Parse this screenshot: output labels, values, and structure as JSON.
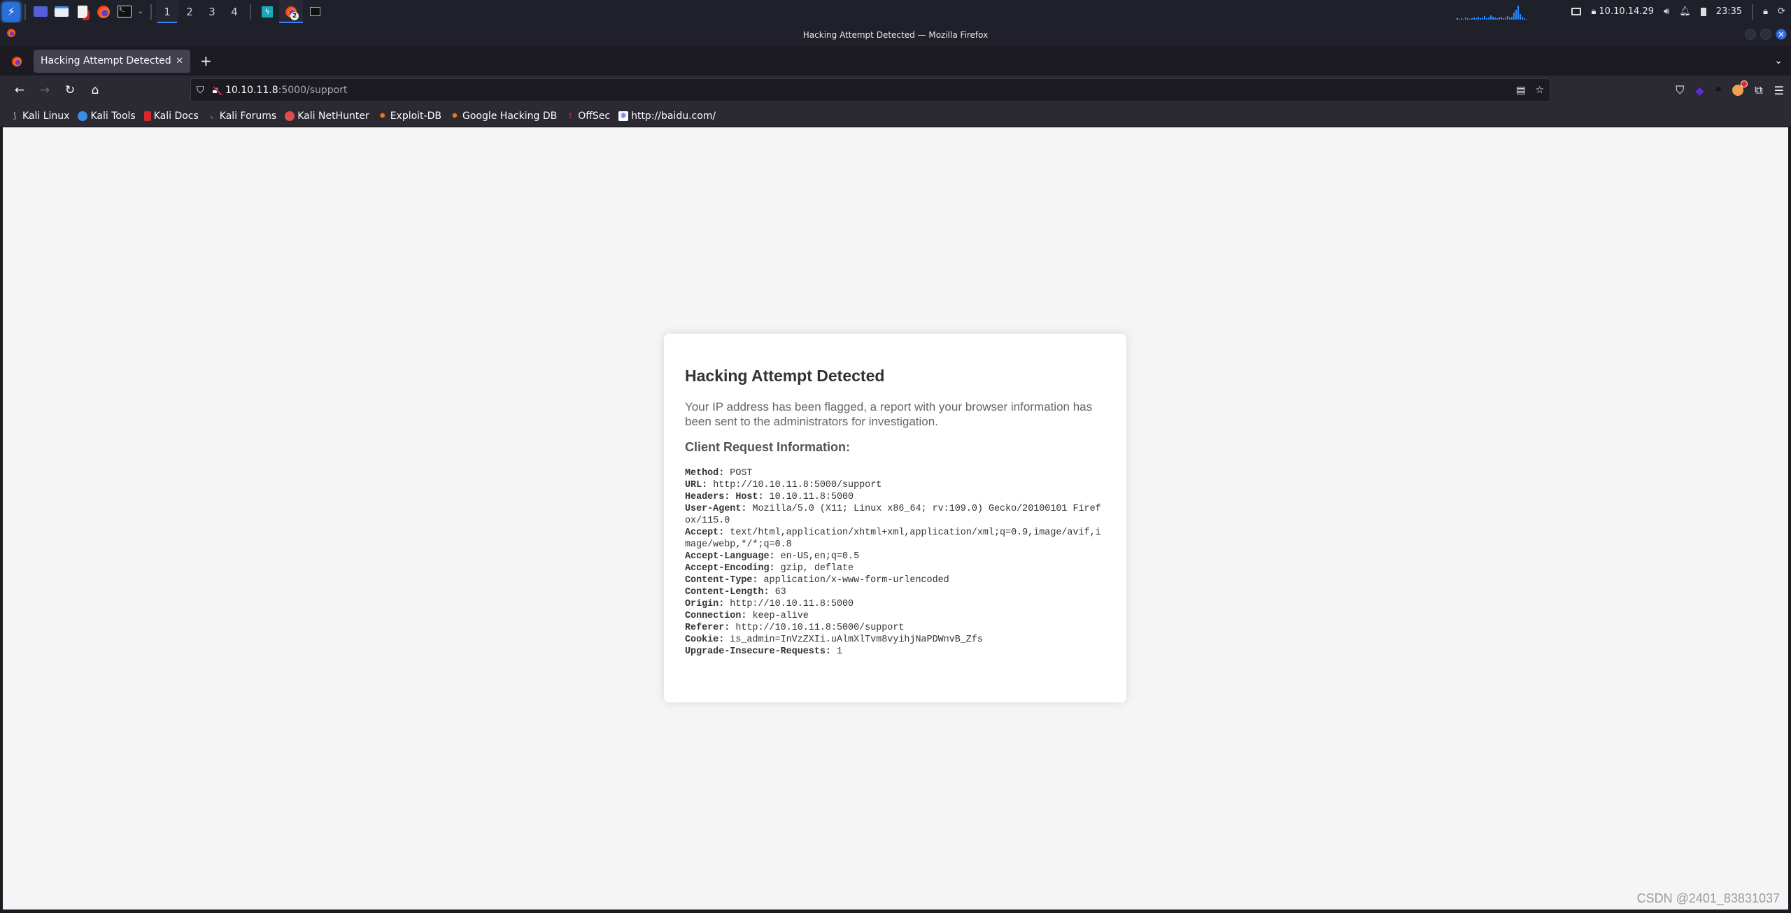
{
  "taskbar": {
    "workspaces": [
      "1",
      "2",
      "3",
      "4"
    ],
    "active_workspace": "1",
    "firefox_task_badge": "2",
    "tray": {
      "ip": "10.10.14.29",
      "time": "23:35"
    }
  },
  "window": {
    "title": "Hacking Attempt Detected — Mozilla Firefox"
  },
  "browser": {
    "tab_title": "Hacking Attempt Detected",
    "url_host": "10.10.11.8",
    "url_path": ":5000/support",
    "bookmarks": [
      {
        "label": "Kali Linux",
        "icon": "kali-dragon-icon",
        "color": "#cccccc"
      },
      {
        "label": "Kali Tools",
        "icon": "kali-tools-icon",
        "color": "#3a8ee6"
      },
      {
        "label": "Kali Docs",
        "icon": "kali-docs-icon",
        "color": "#d42a2a"
      },
      {
        "label": "Kali Forums",
        "icon": "kali-forums-icon",
        "color": "#cccccc"
      },
      {
        "label": "Kali NetHunter",
        "icon": "nethunter-icon",
        "color": "#e24b4b"
      },
      {
        "label": "Exploit-DB",
        "icon": "exploit-db-icon",
        "color": "#f07c1e"
      },
      {
        "label": "Google Hacking DB",
        "icon": "ghdb-icon",
        "color": "#f07c1e"
      },
      {
        "label": "OffSec",
        "icon": "offsec-icon",
        "color": "#d42020"
      },
      {
        "label": "http://baidu.com/",
        "icon": "baidu-icon",
        "color": "#3a62e8"
      }
    ]
  },
  "page": {
    "heading": "Hacking Attempt Detected",
    "message": "Your IP address has been flagged, a report with your browser information has been sent to the administrators for investigation.",
    "subheading": "Client Request Information:",
    "request_info": [
      {
        "key": "Method:",
        "value": " POST"
      },
      {
        "key": "URL:",
        "value": " http://10.10.11.8:5000/support"
      },
      {
        "key": "Headers: Host:",
        "value": " 10.10.11.8:5000"
      },
      {
        "key": "User-Agent:",
        "value": " Mozilla/5.0 (X11; Linux x86_64; rv:109.0) Gecko/20100101 Firefox/115.0"
      },
      {
        "key": "Accept:",
        "value": " text/html,application/xhtml+xml,application/xml;q=0.9,image/avif,image/webp,*/*;q=0.8"
      },
      {
        "key": "Accept-Language:",
        "value": " en-US,en;q=0.5"
      },
      {
        "key": "Accept-Encoding:",
        "value": " gzip, deflate"
      },
      {
        "key": "Content-Type:",
        "value": " application/x-www-form-urlencoded"
      },
      {
        "key": "Content-Length:",
        "value": " 63"
      },
      {
        "key": "Origin:",
        "value": " http://10.10.11.8:5000"
      },
      {
        "key": "Connection:",
        "value": " keep-alive"
      },
      {
        "key": "Referer:",
        "value": " http://10.10.11.8:5000/support"
      },
      {
        "key": "Cookie:",
        "value": " is_admin=InVzZXIi.uAlmXlTvm8vyihjNaPDWnvB_Zfs"
      },
      {
        "key": "Upgrade-Insecure-Requests:",
        "value": " 1"
      }
    ]
  },
  "watermark": "CSDN @2401_83831037"
}
